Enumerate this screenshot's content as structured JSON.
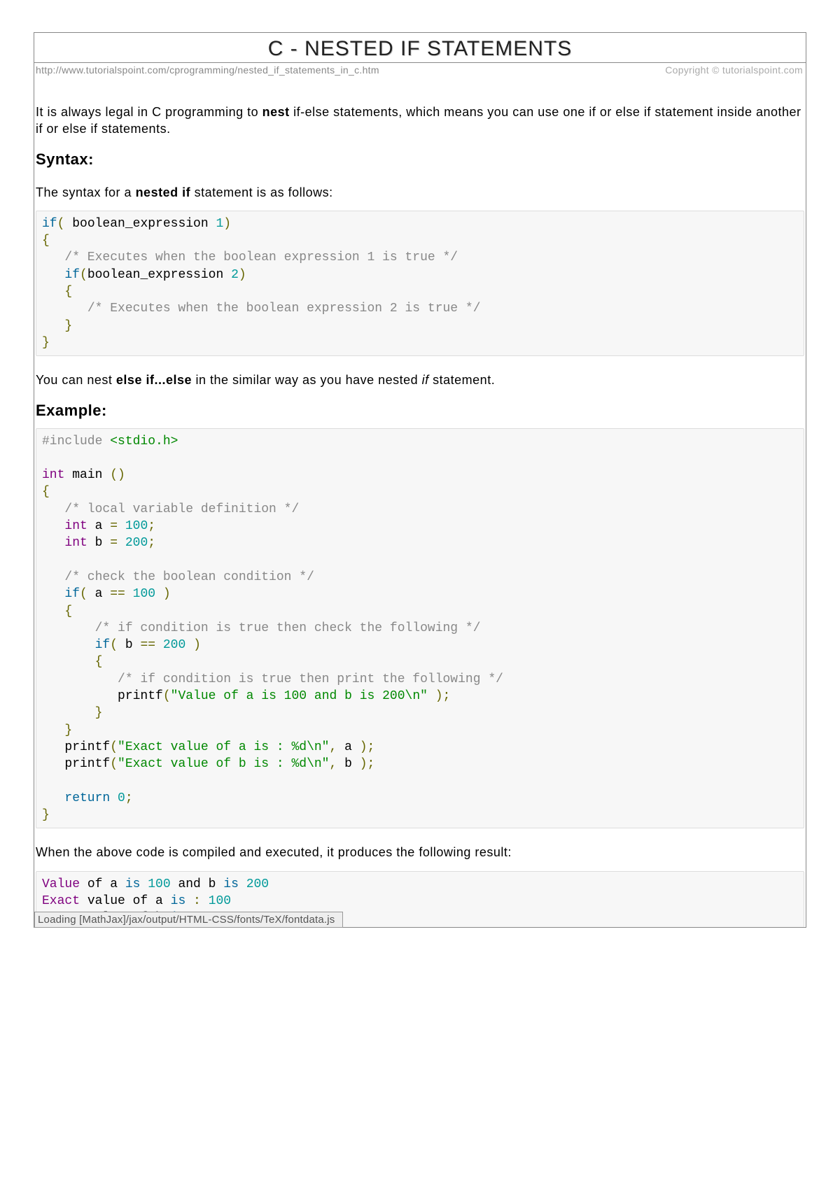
{
  "title": "C - NESTED IF STATEMENTS",
  "meta": {
    "url": "http://www.tutorialspoint.com/cprogramming/nested_if_statements_in_c.htm",
    "copyright": "Copyright © tutorialspoint.com"
  },
  "intro": {
    "pre": "It is always legal in C programming to ",
    "bold": "nest",
    "post": " if-else statements, which means you can use one if or else if statement inside another if or else if statements."
  },
  "syntax_heading": "Syntax:",
  "syntax_intro": {
    "pre": "The syntax for a ",
    "bold": "nested if",
    "post": " statement is as follows:"
  },
  "nest_note": {
    "pre": "You can nest ",
    "bold": "else if...else",
    "mid": " in the similar way as you have nested ",
    "italic": "if",
    "post": " statement."
  },
  "example_heading": "Example:",
  "result_intro": "When the above code is compiled and executed, it produces the following result:",
  "mathjax": "Loading [MathJax]/jax/output/HTML-CSS/fonts/TeX/fontdata.js",
  "code_syntax": {
    "l1_kw": "if",
    "l1_p1": "(",
    "l1_txt": " boolean_expression ",
    "l1_num": "1",
    "l1_p2": ")",
    "l2": "{",
    "l3_com": "/* Executes when the boolean expression 1 is true */",
    "l4_kw": "if",
    "l4_p1": "(",
    "l4_txt": "boolean_expression ",
    "l4_num": "2",
    "l4_p2": ")",
    "l5": "{",
    "l6_com": "/* Executes when the boolean expression 2 is true */",
    "l7": "}",
    "l8": "}"
  },
  "code_example": {
    "l1_dir": "#include ",
    "l1_inc": "<stdio.h>",
    "l2_typ": "int",
    "l2_fn": " main ",
    "l2_p": "()",
    "l3": "{",
    "l4_com": "/* local variable definition */",
    "l5_typ": "int",
    "l5_v": " a ",
    "l5_eq": "=",
    "l5_sp": " ",
    "l5_num": "100",
    "l5_semi": ";",
    "l6_typ": "int",
    "l6_v": " b ",
    "l6_eq": "=",
    "l6_sp": " ",
    "l6_num": "200",
    "l6_semi": ";",
    "l7_com": "/* check the boolean condition */",
    "l8_kw": "if",
    "l8_p1": "(",
    "l8_sp1": " a ",
    "l8_eq": "==",
    "l8_sp2": " ",
    "l8_num": "100",
    "l8_sp3": " ",
    "l8_p2": ")",
    "l9": "{",
    "l10_com": "/* if condition is true then check the following */",
    "l11_kw": "if",
    "l11_p1": "(",
    "l11_sp1": " b ",
    "l11_eq": "==",
    "l11_sp2": " ",
    "l11_num": "200",
    "l11_sp3": " ",
    "l11_p2": ")",
    "l12": "{",
    "l13_com": "/* if condition is true then print the following */",
    "l14_fn": "printf",
    "l14_p1": "(",
    "l14_str": "\"Value of a is 100 and b is 200\\n\"",
    "l14_sp": " ",
    "l14_p2": ");",
    "l15": "}",
    "l16": "}",
    "l17_fn": "printf",
    "l17_p1": "(",
    "l17_str": "\"Exact value of a is : %d\\n\"",
    "l17_c": ",",
    "l17_v": " a ",
    "l17_p2": ");",
    "l18_fn": "printf",
    "l18_p1": "(",
    "l18_str": "\"Exact value of b is : %d\\n\"",
    "l18_c": ",",
    "l18_v": " b ",
    "l18_p2": ");",
    "l19_kw": "return",
    "l19_sp": " ",
    "l19_num": "0",
    "l19_semi": ";",
    "l20": "}"
  },
  "output": {
    "l1_val": "Value",
    "l1_of": " of a ",
    "l1_is": "is",
    "l1_sp1": " ",
    "l1_n1": "100",
    "l1_and": " and b ",
    "l1_is2": "is",
    "l1_sp2": " ",
    "l1_n2": "200",
    "l2_ex": "Exact",
    "l2_txt": " value of a ",
    "l2_is": "is",
    "l2_col": " : ",
    "l2_n": "100",
    "l3_ex": "Exact",
    "l3_txt": " value of b ",
    "l3_is": "is",
    "l3_col": " : ",
    "l3_n": "200"
  }
}
